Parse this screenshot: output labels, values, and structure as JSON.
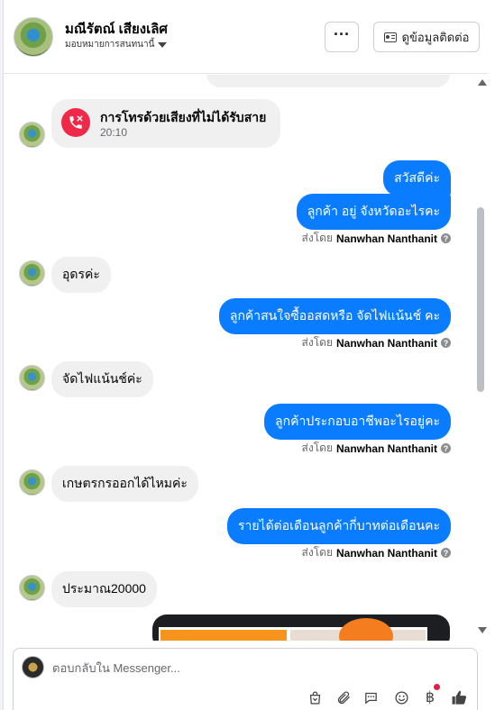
{
  "header": {
    "contact_name": "มณีรัตณ์ เสียงเลิศ",
    "assign_label": "มอบหมายการสนทนานี้",
    "more_label": "···",
    "view_contact_label": "ดูข้อมูลติดต่อ"
  },
  "conversation": {
    "missed_call": {
      "title": "การโทรด้วยเสียงที่ไม่ได้รับสาย",
      "time": "20:10"
    },
    "messages": [
      {
        "direction": "outgoing",
        "text": "สวัสดีค่ะ"
      },
      {
        "direction": "outgoing",
        "text": "ลูกค้า อยู่ จังหวัดอะไรคะ"
      },
      {
        "direction": "incoming",
        "text": "อุดรค่ะ"
      },
      {
        "direction": "outgoing",
        "text": "ลูกค้าสนใจซื้ออสดหรือ จัดไฟแน้นช์ คะ"
      },
      {
        "direction": "incoming",
        "text": "จัดไฟแน้นช์ค่ะ"
      },
      {
        "direction": "outgoing",
        "text": "ลูกค้าประกอบอาชีพอะไรอยู่คะ"
      },
      {
        "direction": "incoming",
        "text": "เกษตรกรออกได้ไหมค่ะ"
      },
      {
        "direction": "outgoing",
        "text": "รายได้ต่อเดือนลูกค้ากี่บาทต่อเดือนคะ"
      },
      {
        "direction": "incoming",
        "text": "ประมาณ20000"
      }
    ],
    "sent_by_prefix": "ส่งโดย",
    "sent_by_name": "Nanwhan Nanthanit",
    "info_glyph": "?"
  },
  "composer": {
    "placeholder": "ตอบกลับใน Messenger...",
    "value": "",
    "tools": [
      "shopping-bag-icon",
      "paperclip-icon",
      "chat-bubble-icon",
      "emoji-icon",
      "baht-icon",
      "like-icon"
    ],
    "baht_glyph": "฿"
  },
  "colors": {
    "outgoing_bubble": "#0a7cff",
    "incoming_bubble": "#f0f0f0",
    "missed_call_red": "#f02849",
    "notification_dot": "#e41e3f"
  }
}
